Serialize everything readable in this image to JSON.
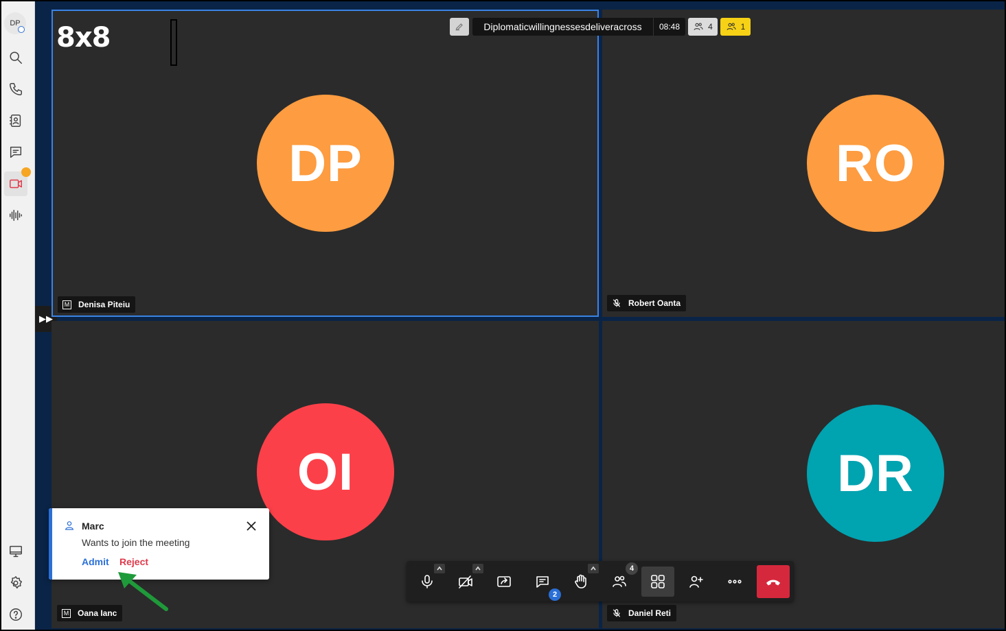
{
  "app": {
    "logo": "8x8",
    "user_initials": "DP"
  },
  "sidebar": {
    "items": [
      {
        "name": "search-icon"
      },
      {
        "name": "phone-icon"
      },
      {
        "name": "contacts-icon"
      },
      {
        "name": "chat-icon"
      },
      {
        "name": "video-icon",
        "active": true
      },
      {
        "name": "voice-icon"
      },
      {
        "name": "desktop-icon"
      },
      {
        "name": "gear-icon"
      },
      {
        "name": "help-icon"
      }
    ]
  },
  "meeting": {
    "title": "Diplomaticwillingnessesdeliveracross",
    "duration": "08:48",
    "participants_count": "4",
    "waiting_count": "1"
  },
  "tiles": [
    {
      "initials": "DP",
      "name": "Denisa Piteiu",
      "color": "#fd9c40",
      "tag": "M"
    },
    {
      "initials": "RO",
      "name": "Robert Oanta",
      "color": "#fd9c40",
      "muted": true
    },
    {
      "initials": "OI",
      "name": "Oana Ianc",
      "color": "#fc4049",
      "tag": "M"
    },
    {
      "initials": "DR",
      "name": "Daniel Reti",
      "color": "#00a3b0",
      "muted": true
    }
  ],
  "toolbar": {
    "chat_badge": "2",
    "participants_badge": "4"
  },
  "toast": {
    "name": "Marc",
    "message": "Wants to join the meeting",
    "admit_label": "Admit",
    "reject_label": "Reject"
  },
  "colors": {
    "accent_blue": "#2a6fd6",
    "reject_red": "#e0394a",
    "leave_red": "#d6283d",
    "waiting_yellow": "#f7d116"
  }
}
